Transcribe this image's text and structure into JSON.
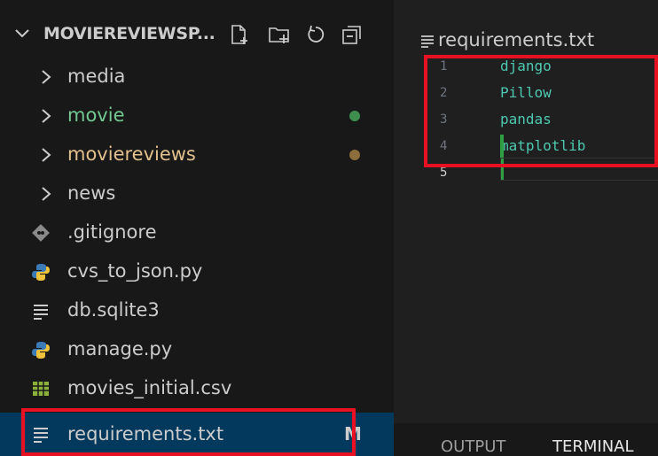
{
  "explorer": {
    "project_title": "MOVIEREVIEWSP...",
    "header_icons": [
      "new-file-icon",
      "new-folder-icon",
      "refresh-icon",
      "collapse-all-icon"
    ],
    "items": [
      {
        "label": "media",
        "type": "folder",
        "color": "#cccccc"
      },
      {
        "label": "movie",
        "type": "folder",
        "color": "#73c991",
        "dot_color": "#3f8e4f"
      },
      {
        "label": "moviereviews",
        "type": "folder",
        "color": "#e2c08d",
        "dot_color": "#8c6d3b"
      },
      {
        "label": "news",
        "type": "folder",
        "color": "#cccccc"
      },
      {
        "label": ".gitignore",
        "type": "file",
        "icon": "git-icon",
        "color": "#cccccc"
      },
      {
        "label": "cvs_to_json.py",
        "type": "file",
        "icon": "python-icon",
        "color": "#cccccc"
      },
      {
        "label": "db.sqlite3",
        "type": "file",
        "icon": "text-lines-icon",
        "color": "#cccccc"
      },
      {
        "label": "manage.py",
        "type": "file",
        "icon": "python-icon",
        "color": "#cccccc"
      },
      {
        "label": "movies_initial.csv",
        "type": "file",
        "icon": "table-icon",
        "color": "#cccccc"
      },
      {
        "label": "requirements.txt",
        "type": "file",
        "icon": "text-lines-icon",
        "color": "#cccccc",
        "badge": "M",
        "selected": true
      }
    ]
  },
  "editor": {
    "tab_title": "requirements.txt",
    "lines": [
      {
        "number": "1",
        "text": "django"
      },
      {
        "number": "2",
        "text": "Pillow"
      },
      {
        "number": "3",
        "text": "pandas"
      },
      {
        "number": "4",
        "text": "matplotlib"
      },
      {
        "number": "5",
        "text": ""
      }
    ]
  },
  "panel": {
    "tabs": [
      "OUTPUT",
      "TERMINAL"
    ]
  },
  "colors": {
    "sidebar_bg": "#181818",
    "editor_bg": "#1f1f1f",
    "selection_bg": "#04395e",
    "annotation_red": "#e81123",
    "code_text": "#4ec9b0",
    "git_added": "#2ea043"
  }
}
